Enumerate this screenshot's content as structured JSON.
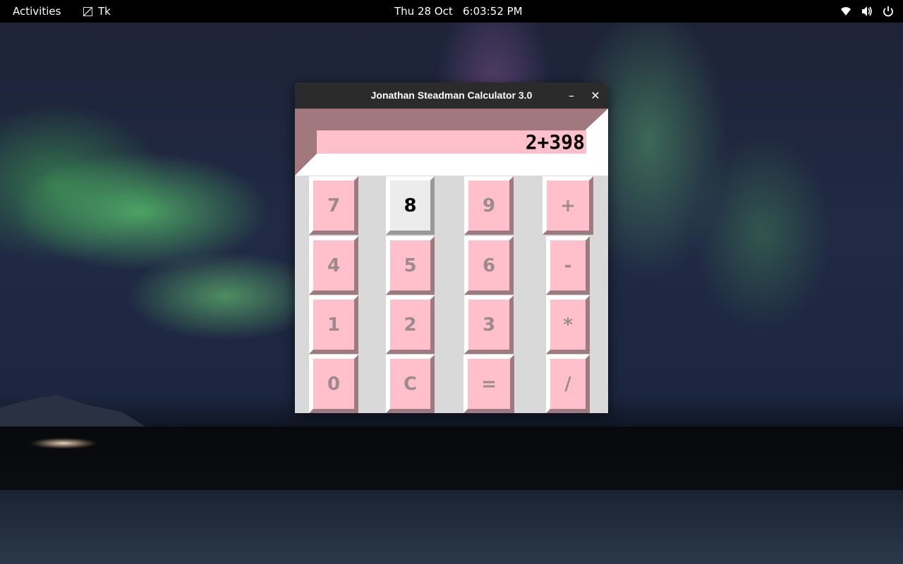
{
  "topbar": {
    "activities": "Activities",
    "app_name": "Tk",
    "clock": "Thu 28 Oct   6:03:52 PM",
    "icons": [
      "wifi-icon",
      "volume-icon",
      "power-icon"
    ]
  },
  "window": {
    "title": "Jonathan Steadman Calculator 3.0",
    "minimize_label": "–",
    "close_label": "✕"
  },
  "display": {
    "value": "2+398"
  },
  "keys": {
    "k7": "7",
    "k8": "8",
    "k9": "9",
    "plus": "+",
    "k4": "4",
    "k5": "5",
    "k6": "6",
    "minus": "-",
    "k1": "1",
    "k2": "2",
    "k3": "3",
    "mul": "*",
    "k0": "0",
    "clear": "C",
    "equals": "=",
    "div": "/"
  },
  "colors": {
    "key_face": "#ffc0cb",
    "key_shadow": "#9c7b80",
    "key_text": "#9c8a8d",
    "active_key_face": "#ececec",
    "display_bg": "#ffc0cb",
    "display_frame": "#a1787d"
  }
}
